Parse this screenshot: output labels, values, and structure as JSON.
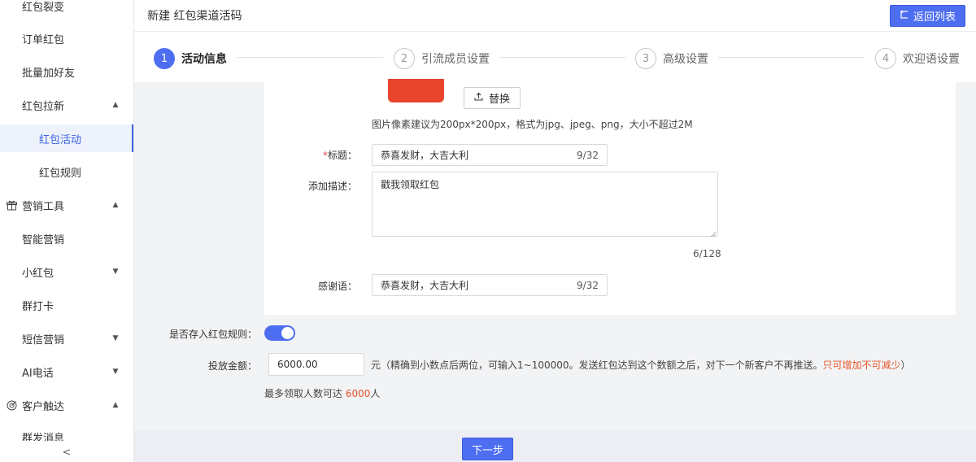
{
  "sidebar": {
    "items": [
      {
        "label": "红包裂变",
        "type": "item"
      },
      {
        "label": "订单红包",
        "type": "item"
      },
      {
        "label": "批量加好友",
        "type": "item"
      },
      {
        "label": "红包拉新",
        "type": "item",
        "chevron": "up"
      },
      {
        "label": "红包活动",
        "type": "sub",
        "active": true
      },
      {
        "label": "红包规则",
        "type": "sub"
      },
      {
        "label": "营销工具",
        "type": "group",
        "icon": "gift-icon",
        "chevron": "up"
      },
      {
        "label": "智能营销",
        "type": "item"
      },
      {
        "label": "小红包",
        "type": "item",
        "chevron": "down"
      },
      {
        "label": "群打卡",
        "type": "item"
      },
      {
        "label": "短信营销",
        "type": "item",
        "chevron": "down"
      },
      {
        "label": "AI电话",
        "type": "item",
        "chevron": "down"
      },
      {
        "label": "客户触达",
        "type": "group",
        "icon": "target-icon",
        "chevron": "up"
      },
      {
        "label": "群发消息",
        "type": "item"
      }
    ],
    "collapse_glyph": "<"
  },
  "header": {
    "title": "新建 红包渠道活码",
    "back_label": "返回列表"
  },
  "steps": [
    {
      "num": "1",
      "label": "活动信息",
      "active": true
    },
    {
      "num": "2",
      "label": "引流成员设置"
    },
    {
      "num": "3",
      "label": "高级设置"
    },
    {
      "num": "4",
      "label": "欢迎语设置"
    }
  ],
  "form": {
    "replace_label": "替换",
    "image_hint": "图片像素建议为200px*200px，格式为jpg、jpeg、png，大小不超过2M",
    "title": {
      "req": "*",
      "label": "标题：",
      "value": "恭喜发财，大吉大利",
      "count": "9/32"
    },
    "desc": {
      "label": "添加描述：",
      "value": "戳我领取红包",
      "count": "6/128"
    },
    "thanks": {
      "label": "感谢语：",
      "value": "恭喜发财，大吉大利",
      "count": "9/32"
    },
    "save_rule_label": "是否存入红包规则：",
    "save_rule_on": true,
    "amount": {
      "label": "投放金额：",
      "value": "6000.00",
      "note": "元（精确到小数点后两位，可输入1~100000。发送红包达到这个数额之后，对下一个新客户不再推送。",
      "warn": "只可增加不可减少",
      "note_end": "）"
    },
    "max_note_prefix": "最多领取人数可达 ",
    "max_note_num": "6000",
    "max_note_suffix": "人"
  },
  "footer": {
    "next_label": "下一步"
  },
  "colors": {
    "primary": "#4e6ef2",
    "warn": "#e8562c",
    "thumb": "#e8452d"
  }
}
